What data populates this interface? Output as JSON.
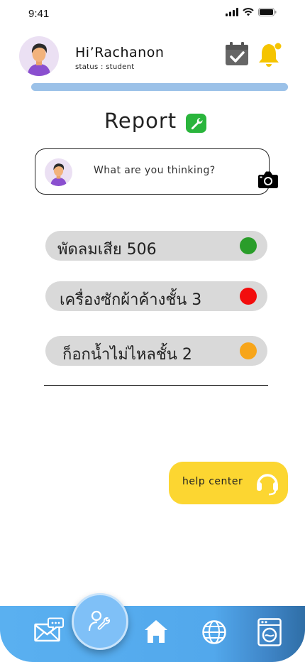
{
  "status_bar": {
    "time": "9:41"
  },
  "header": {
    "greeting": "Hi’Rachanon",
    "status": "status : student",
    "progress_fraction": 1.0
  },
  "page": {
    "title": "Report"
  },
  "composer": {
    "placeholder": "What are you thinking?"
  },
  "reports": [
    {
      "label": "พัดลมเสีย 506",
      "status_color": "#2a9d2a"
    },
    {
      "label": "เครื่องซักผ้าค้างชั้น 3",
      "status_color": "#f20d0d"
    },
    {
      "label": "ก็อกน้ำไม่ไหลชั้น 2",
      "status_color": "#f7a51a"
    }
  ],
  "help_center": {
    "label": "help center"
  },
  "colors": {
    "accent_yellow": "#fcd631",
    "progress_bar": "#9bc1e8",
    "nav_blue": "#5ab0f0",
    "wrench_green": "#2ab53c"
  },
  "icons": {
    "header": [
      "calendar-check-icon",
      "bell-icon"
    ],
    "nav": [
      "mail-chat-icon",
      "repair-user-icon",
      "home-icon",
      "globe-icon",
      "washing-machine-icon"
    ]
  }
}
